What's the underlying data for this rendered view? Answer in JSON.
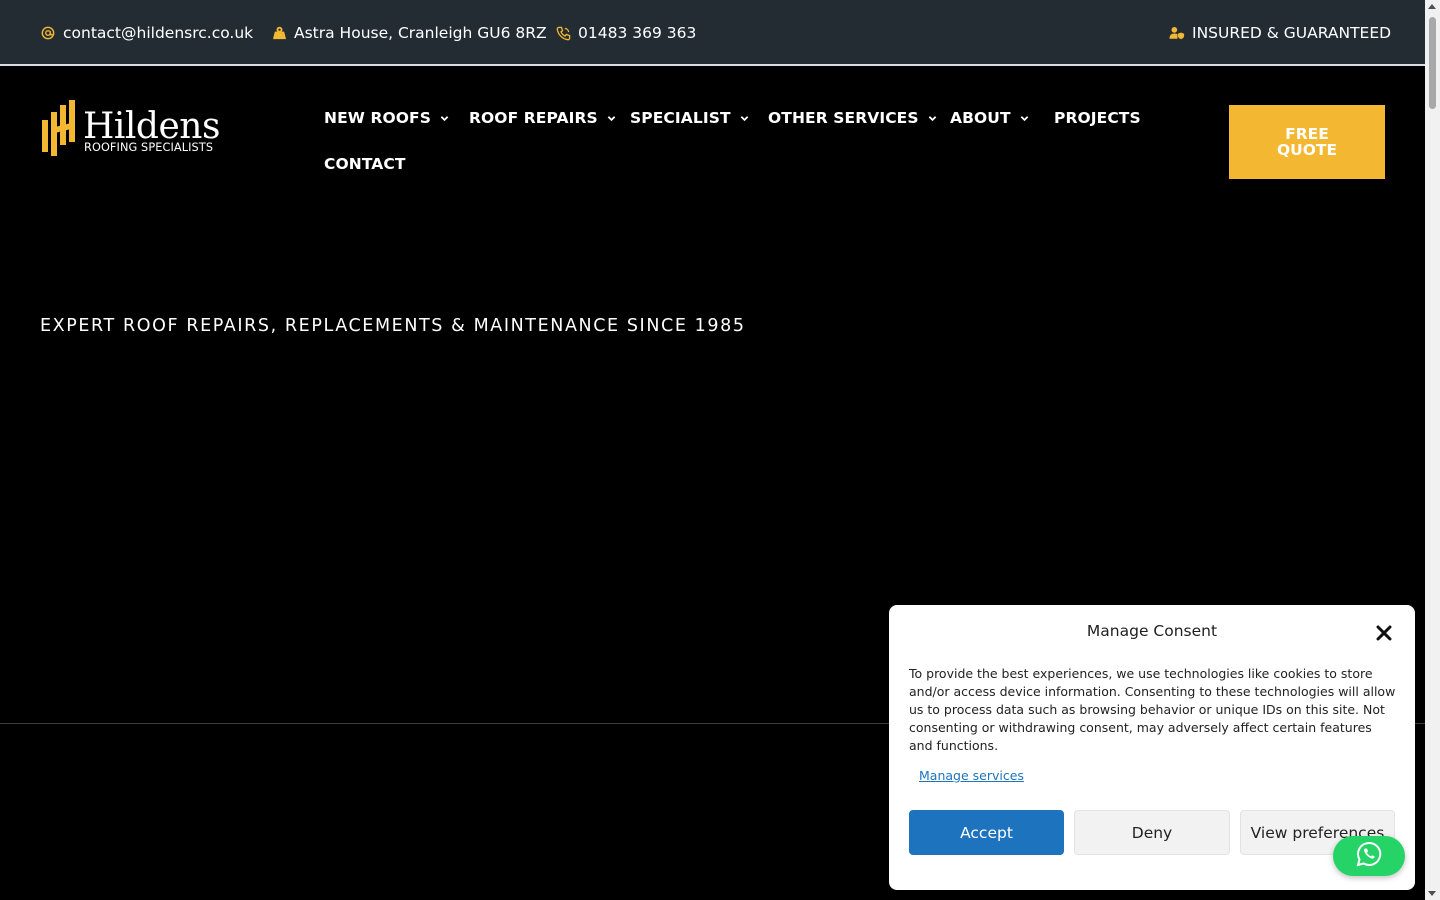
{
  "topbar": {
    "email": "contact@hildensrc.co.uk",
    "address": "Astra House, Cranleigh GU6 8RZ",
    "phone": "01483 369 363",
    "badge": "INSURED & GUARANTEED",
    "icons": [
      "at-icon",
      "map-icon",
      "phone-icon",
      "user-shield-icon"
    ]
  },
  "logo": {
    "name": "Hildens",
    "subtitle": "ROOFING SPECIALISTS"
  },
  "nav": {
    "items": [
      {
        "label": "NEW ROOFS",
        "has_dropdown": true
      },
      {
        "label": "ROOF REPAIRS",
        "has_dropdown": true
      },
      {
        "label": "SPECIALIST",
        "has_dropdown": true
      },
      {
        "label": "OTHER SERVICES",
        "has_dropdown": true
      },
      {
        "label": "ABOUT",
        "has_dropdown": true
      },
      {
        "label": "PROJECTS",
        "has_dropdown": false
      },
      {
        "label": "CONTACT",
        "has_dropdown": false
      }
    ],
    "cta": "FREE QUOTE"
  },
  "hero": {
    "tagline": "EXPERT ROOF REPAIRS, REPLACEMENTS & MAINTENANCE SINCE 1985"
  },
  "consent": {
    "title": "Manage Consent",
    "body": "To provide the best experiences, we use technologies like cookies to store and/or access device information. Consenting to these technologies will allow us to process data such as browsing behavior or unique IDs on this site. Not consenting or withdrawing consent, may adversely affect certain features and functions.",
    "manage_link": "Manage services",
    "accept": "Accept",
    "deny": "Deny",
    "preferences": "View preferences"
  },
  "colors": {
    "accent": "#f4b731",
    "topbar_bg": "#232c33",
    "consent_primary": "#1e73be",
    "whatsapp": "#25d366"
  }
}
